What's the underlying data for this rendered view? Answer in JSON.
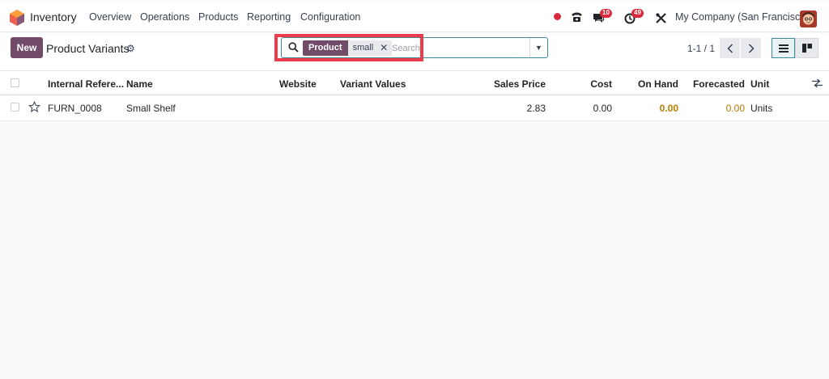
{
  "navbar": {
    "app_name": "Inventory",
    "menu": [
      "Overview",
      "Operations",
      "Products",
      "Reporting",
      "Configuration"
    ],
    "messages_count": "10",
    "activities_count": "49",
    "company": "My Company (San Francisco)"
  },
  "control": {
    "new_label": "New",
    "title": "Product Variants",
    "search": {
      "facet_label": "Product",
      "facet_value": "small",
      "placeholder": "Search"
    },
    "pager": "1-1 / 1"
  },
  "table": {
    "columns": [
      "Internal Refere...",
      "Name",
      "Website",
      "Variant Values",
      "Sales Price",
      "Cost",
      "On Hand",
      "Forecasted",
      "Unit"
    ],
    "rows": [
      {
        "internal_ref": "FURN_0008",
        "name": "Small Shelf",
        "website": "",
        "variant_values": "",
        "sales_price": "2.83",
        "cost": "0.00",
        "on_hand": "0.00",
        "forecasted": "0.00",
        "unit": "Units"
      }
    ]
  },
  "colors": {
    "brand": "#714b67",
    "accent": "#3c8a99",
    "badge": "#d9293d",
    "highlight": "#ec3c4b",
    "warning": "#b87b00"
  }
}
